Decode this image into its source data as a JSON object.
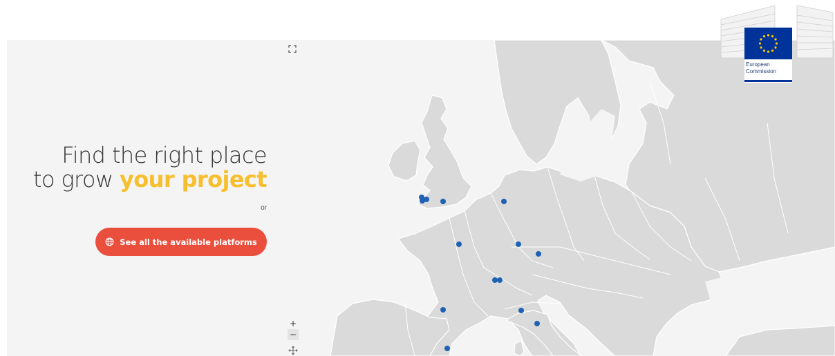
{
  "hero": {
    "line1": "Find the right place",
    "line2_prefix": "to grow ",
    "line2_highlight": "your project",
    "or_text": "or"
  },
  "cta": {
    "label": "See all the available platforms",
    "icon": "globe-icon"
  },
  "map_controls": {
    "zoom_in": "+",
    "zoom_out": "−",
    "fullscreen_icon": "fullscreen-icon",
    "pan_icon": "pan-arrows-icon"
  },
  "logo": {
    "line1": "European",
    "line2": "Commission"
  },
  "colors": {
    "accent_yellow": "#f7bf2d",
    "cta_red": "#ea4e3c",
    "marker_blue": "#1f62b4",
    "land_gray": "#dadada",
    "sea_gray": "#f4f4f4",
    "eu_blue": "#003399",
    "eu_star": "#ffcc00"
  }
}
